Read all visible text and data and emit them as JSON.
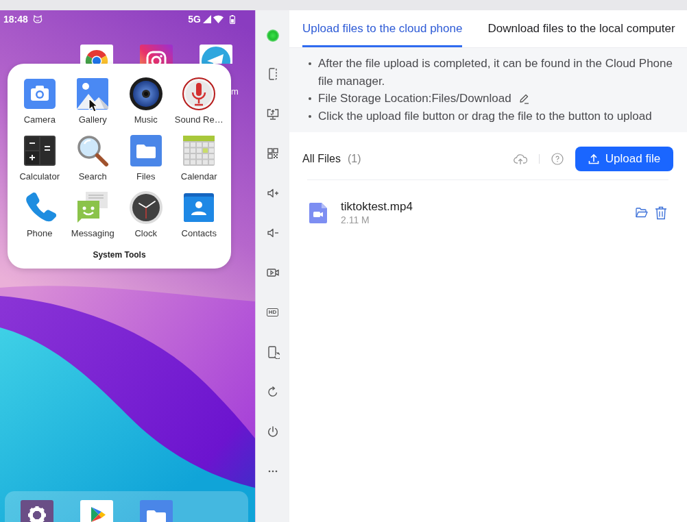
{
  "phone": {
    "status_bar": {
      "time": "18:48",
      "network": "5G"
    },
    "home_screen": {
      "label_fragment": "m"
    },
    "folder": {
      "title": "System Tools",
      "apps": [
        {
          "label": "Camera"
        },
        {
          "label": "Gallery"
        },
        {
          "label": "Music"
        },
        {
          "label": "Sound Re…"
        },
        {
          "label": "Calculator"
        },
        {
          "label": "Search"
        },
        {
          "label": "Files"
        },
        {
          "label": "Calendar"
        },
        {
          "label": "Phone"
        },
        {
          "label": "Messaging"
        },
        {
          "label": "Clock"
        },
        {
          "label": "Contacts"
        }
      ]
    }
  },
  "toolbar": {
    "quality_label": "HD"
  },
  "tabs": [
    {
      "label": "Upload files to the cloud phone",
      "selected": true
    },
    {
      "label": "Download files to the local computer",
      "selected": false
    }
  ],
  "notes": [
    {
      "text": "After the file upload is completed, it can be found in the Cloud Phone file manager.",
      "editable": false
    },
    {
      "text": "File Storage Location:Files/Download",
      "editable": true
    },
    {
      "text": "Click the upload file button or drag the file to the button to upload",
      "editable": false
    }
  ],
  "files": {
    "title": "All Files",
    "count": "(1)",
    "upload_button": "Upload file",
    "items": [
      {
        "name": "tiktoktest.mp4",
        "size": "2.11 M"
      }
    ]
  }
}
